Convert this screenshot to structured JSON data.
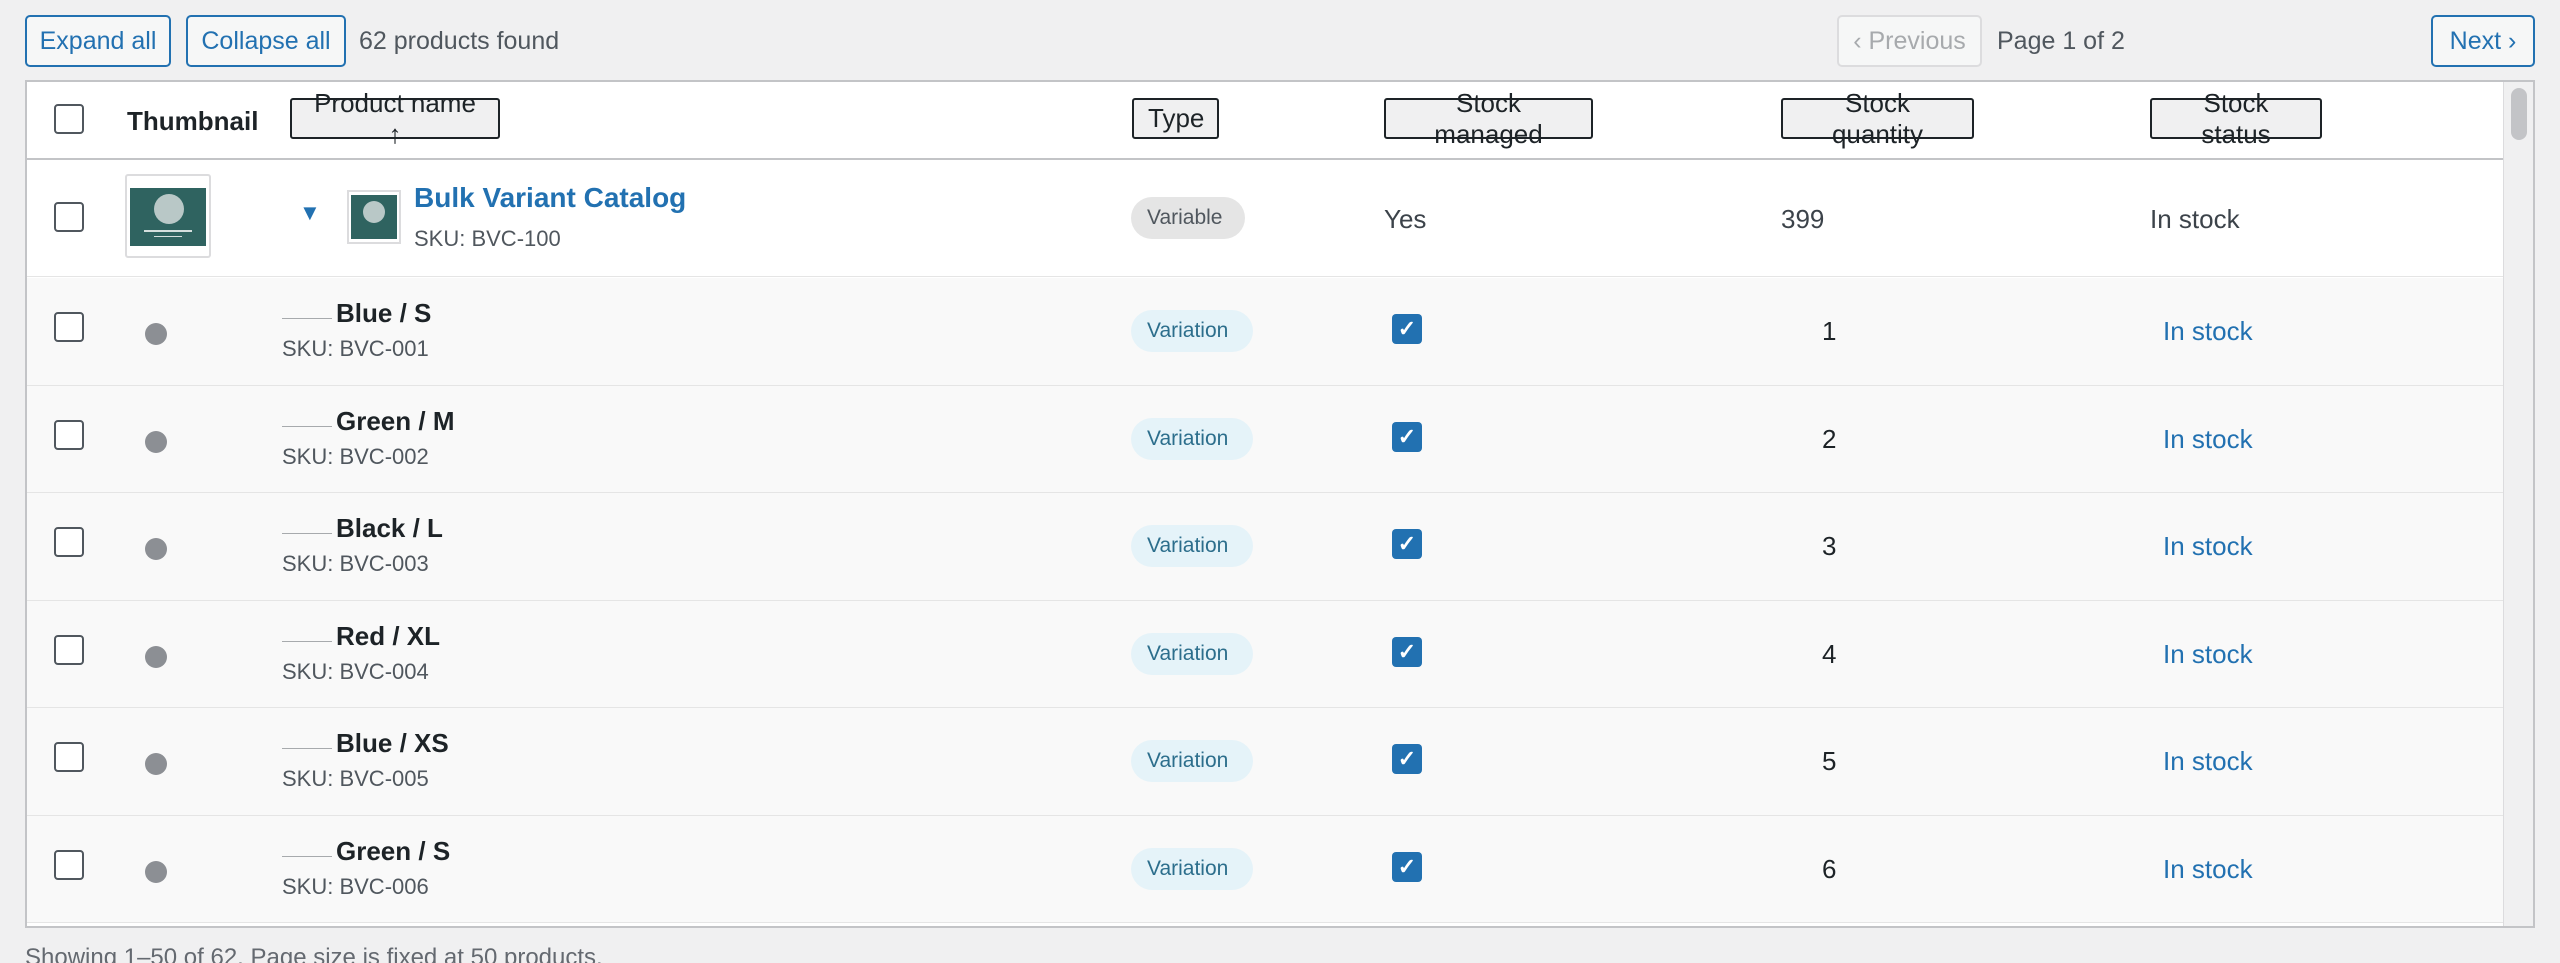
{
  "toolbar": {
    "expand_label": "Expand all",
    "collapse_label": "Collapse all",
    "found_text": "62 products found",
    "prev_label": "‹ Previous",
    "page_info": "Page 1 of 2",
    "next_label": "Next ›"
  },
  "table": {
    "headers": {
      "thumbnail": "Thumbnail",
      "product_name": "Product name ↑",
      "type": "Type",
      "stock_managed": "Stock managed",
      "stock_quantity": "Stock quantity",
      "stock_status": "Stock status"
    },
    "parent": {
      "name": "Bulk Variant Catalog",
      "sku": "SKU: BVC-100",
      "type": "Variable",
      "stock_managed": "Yes",
      "stock_quantity": "399",
      "stock_status": "In stock",
      "expanded_icon": "triangle-down-icon"
    },
    "variations": [
      {
        "name": "Blue / S",
        "sku": "SKU: BVC-001",
        "type": "Variation",
        "stock_managed": true,
        "stock_quantity": "1",
        "stock_status": "In stock"
      },
      {
        "name": "Green / M",
        "sku": "SKU: BVC-002",
        "type": "Variation",
        "stock_managed": true,
        "stock_quantity": "2",
        "stock_status": "In stock"
      },
      {
        "name": "Black / L",
        "sku": "SKU: BVC-003",
        "type": "Variation",
        "stock_managed": true,
        "stock_quantity": "3",
        "stock_status": "In stock"
      },
      {
        "name": "Red / XL",
        "sku": "SKU: BVC-004",
        "type": "Variation",
        "stock_managed": true,
        "stock_quantity": "4",
        "stock_status": "In stock"
      },
      {
        "name": "Blue / XS",
        "sku": "SKU: BVC-005",
        "type": "Variation",
        "stock_managed": true,
        "stock_quantity": "5",
        "stock_status": "In stock"
      },
      {
        "name": "Green / S",
        "sku": "SKU: BVC-006",
        "type": "Variation",
        "stock_managed": true,
        "stock_quantity": "6",
        "stock_status": "In stock"
      }
    ]
  },
  "footer": {
    "note": "Showing 1–50 of 62. Page size is fixed at 50 products."
  },
  "colors": {
    "accent": "#2271b1",
    "thumbnail_bg": "#2f6360"
  }
}
